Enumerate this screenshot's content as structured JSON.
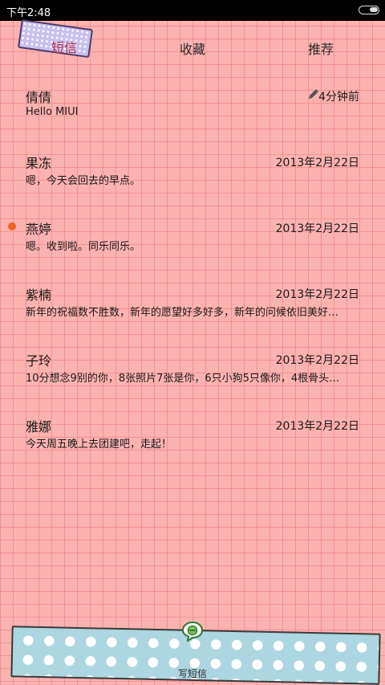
{
  "status_bar": {
    "time": "下午2:48"
  },
  "tabs": [
    {
      "label": "短信",
      "active": true
    },
    {
      "label": "收藏",
      "active": false
    },
    {
      "label": "推荐",
      "active": false
    }
  ],
  "messages": [
    {
      "name": "倩倩",
      "date": "4分钟前",
      "snippet": "Hello MIUI",
      "has_draft_icon": true,
      "unread": false
    },
    {
      "name": "果冻",
      "date": "2013年2月22日",
      "snippet": "嗯，今天会回去的早点。",
      "unread": false
    },
    {
      "name": "燕婷",
      "date": "2013年2月22日",
      "snippet": "嗯。收到啦。同乐同乐。",
      "unread": true
    },
    {
      "name": "紫楠",
      "date": "2013年2月22日",
      "snippet": "新年的祝福数不胜数，新年的愿望好多好多，新年的问候依旧美好…",
      "unread": false
    },
    {
      "name": "子玲",
      "date": "2013年2月22日",
      "snippet": "10分想念9别的你，8张照片7张是你，6只小狗5只像你，4根骨头…",
      "unread": false
    },
    {
      "name": "雅娜",
      "date": "2013年2月22日",
      "snippet": "今天周五晚上去团建吧，走起！",
      "unread": false
    }
  ],
  "compose": {
    "label": "写短信"
  },
  "colors": {
    "unread_dot": "#f26322",
    "active_tab_text": "#b13048",
    "background": "#fbb3b1"
  }
}
